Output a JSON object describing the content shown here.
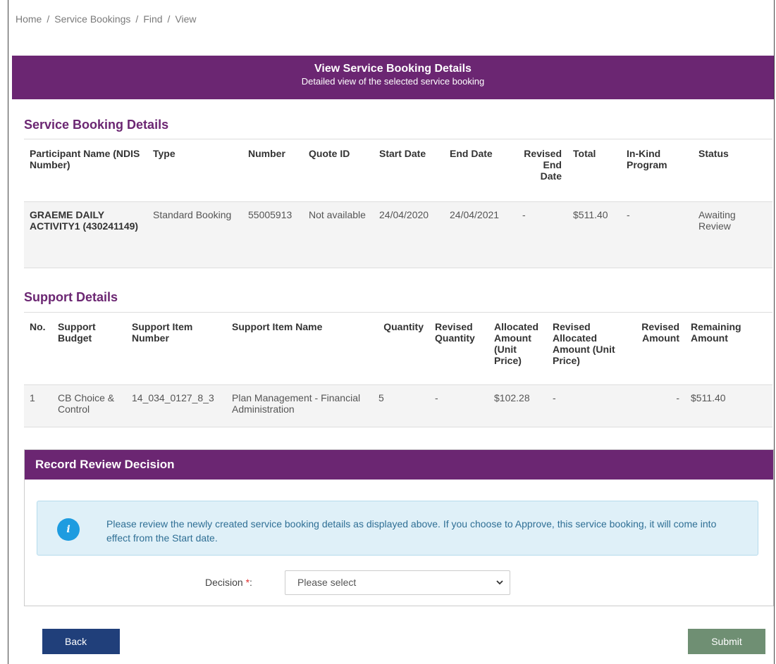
{
  "breadcrumb": [
    "Home",
    "Service Bookings",
    "Find",
    "View"
  ],
  "header": {
    "title": "View Service Booking Details",
    "subtitle": "Detailed view of the selected service booking"
  },
  "booking": {
    "section_title": "Service Booking Details",
    "columns": [
      "Participant Name (NDIS Number)",
      "Type",
      "Number",
      "Quote ID",
      "Start Date",
      "End Date",
      "Revised End Date",
      "Total",
      "In-Kind Program",
      "Status"
    ],
    "row": {
      "participant": "GRAEME DAILY ACTIVITY1 (430241149)",
      "type": "Standard Booking",
      "number": "55005913",
      "quote_id": "Not available",
      "start_date": "24/04/2020",
      "end_date": "24/04/2021",
      "revised_end_date": "-",
      "total": "$511.40",
      "in_kind": "-",
      "status": "Awaiting Review"
    }
  },
  "support": {
    "section_title": "Support Details",
    "columns": [
      "No.",
      "Support Budget",
      "Support Item Number",
      "Support Item Name",
      "Quantity",
      "Revised Quantity",
      "Allocated Amount (Unit Price)",
      "Revised Allocated Amount (Unit Price)",
      "Revised Amount",
      "Remaining Amount"
    ],
    "row": {
      "no": "1",
      "budget": "CB Choice & Control",
      "item_number": "14_034_0127_8_3",
      "item_name": "Plan Management - Financial Administration",
      "quantity": "5",
      "revised_quantity": "-",
      "allocated_amount": "$102.28",
      "revised_allocated_amount": "-",
      "revised_amount": "-",
      "remaining_amount": "$511.40"
    }
  },
  "review": {
    "title": "Record Review Decision",
    "info": "Please review the newly created service booking details as displayed above. If you choose to Approve, this service booking, it will come into effect from the Start date.",
    "decision_label": "Decision",
    "required_mark": "*",
    "decision_colon": ":",
    "decision_value": "Please select"
  },
  "buttons": {
    "back": "Back",
    "submit": "Submit"
  },
  "icons": {
    "info": "info-icon",
    "dropdown": "chevron-down-icon"
  },
  "colors": {
    "brand": "#6b2672",
    "info_bg": "#dff0f8",
    "back_button": "#203f7a",
    "submit_button": "#6f8f73"
  }
}
